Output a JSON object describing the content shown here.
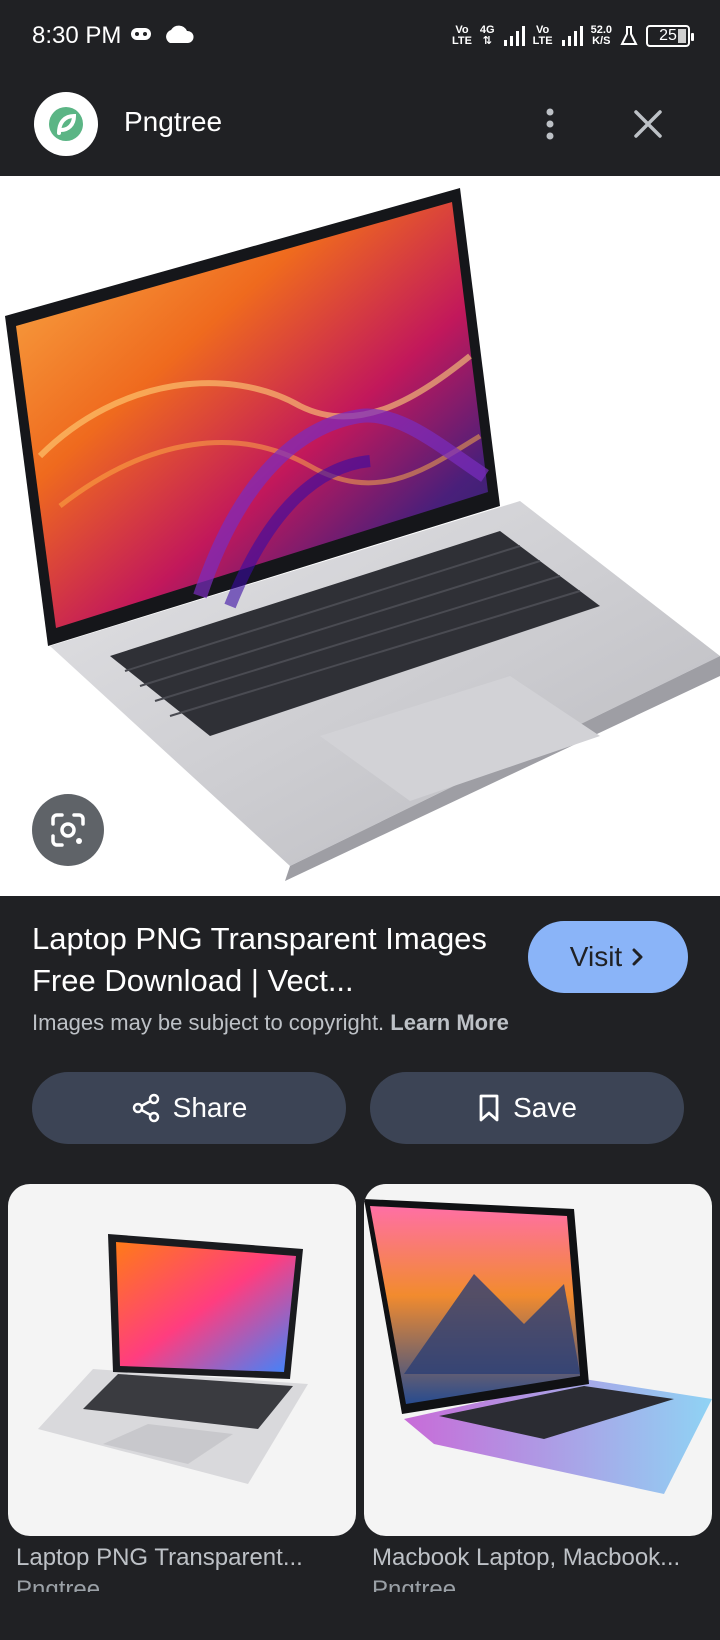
{
  "status_bar": {
    "time": "8:30 PM",
    "net1_top": "Vo",
    "net1_bottom": "LTE",
    "net_4g": "4G",
    "net2_top": "Vo",
    "net2_bottom": "LTE",
    "speed_top": "52.0",
    "speed_bottom": "K/S",
    "battery": "25"
  },
  "header": {
    "site_name": "Pngtree"
  },
  "result": {
    "title": "Laptop PNG Transparent Images Free Download | Vect...",
    "visit_label": "Visit",
    "copyright_text": "Images may be subject to copyright.",
    "learn_more": "Learn More"
  },
  "actions": {
    "share_label": "Share",
    "save_label": "Save"
  },
  "related": [
    {
      "title": "Laptop PNG Transparent...",
      "source": "Pngtree"
    },
    {
      "title": "Macbook Laptop, Macbook...",
      "source": "Pngtree"
    }
  ],
  "colors": {
    "background": "#202124",
    "visit_button": "#8ab4f8",
    "action_button": "#3c4455",
    "brand_green": "#5bb585"
  }
}
